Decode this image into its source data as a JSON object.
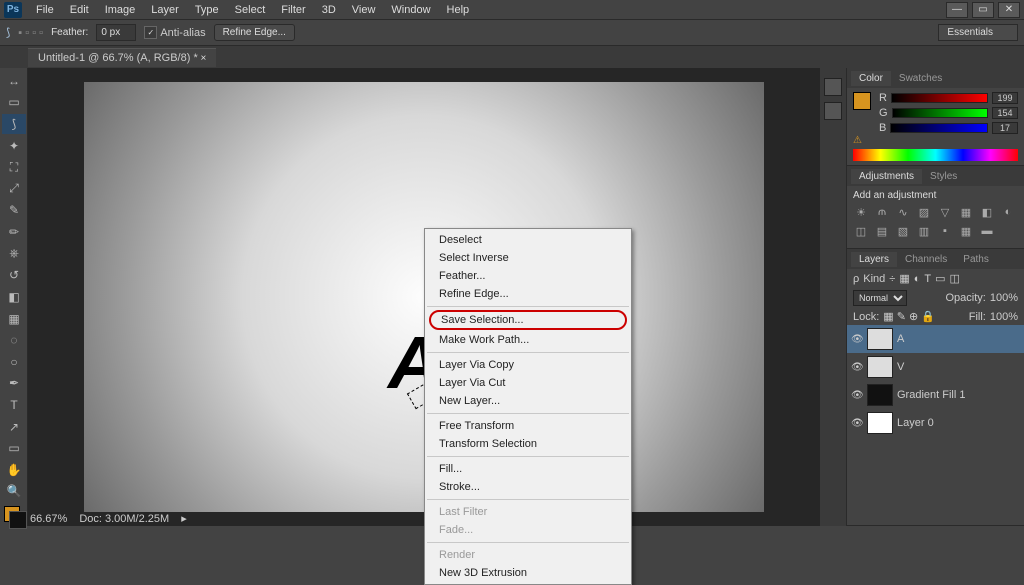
{
  "app": {
    "logo": "Ps"
  },
  "menu": [
    "File",
    "Edit",
    "Image",
    "Layer",
    "Type",
    "Select",
    "Filter",
    "3D",
    "View",
    "Window",
    "Help"
  ],
  "options": {
    "feather_label": "Feather:",
    "feather_value": "0 px",
    "antialias": "Anti-alias",
    "refine": "Refine Edge..."
  },
  "workspace": "Essentials",
  "doc_tab": "Untitled-1 @ 66.7% (A, RGB/8) *",
  "context_menu": {
    "items": [
      {
        "label": "Deselect",
        "enabled": true
      },
      {
        "label": "Select Inverse",
        "enabled": true
      },
      {
        "label": "Feather...",
        "enabled": true
      },
      {
        "label": "Refine Edge...",
        "enabled": true
      }
    ],
    "items2": [
      {
        "label": "Save Selection...",
        "enabled": true,
        "highlight": true
      },
      {
        "label": "Make Work Path...",
        "enabled": true
      }
    ],
    "items3": [
      {
        "label": "Layer Via Copy",
        "enabled": true
      },
      {
        "label": "Layer Via Cut",
        "enabled": true
      },
      {
        "label": "New Layer...",
        "enabled": true
      }
    ],
    "items4": [
      {
        "label": "Free Transform",
        "enabled": true
      },
      {
        "label": "Transform Selection",
        "enabled": true
      }
    ],
    "items5": [
      {
        "label": "Fill...",
        "enabled": true
      },
      {
        "label": "Stroke...",
        "enabled": true
      }
    ],
    "items6": [
      {
        "label": "Last Filter",
        "enabled": false
      },
      {
        "label": "Fade...",
        "enabled": false
      }
    ],
    "items7": [
      {
        "label": "Render",
        "enabled": false
      },
      {
        "label": "New 3D Extrusion",
        "enabled": true
      }
    ]
  },
  "panels": {
    "color_tab": "Color",
    "swatches_tab": "Swatches",
    "r_label": "R",
    "r_val": "199",
    "g_label": "G",
    "g_val": "154",
    "b_label": "B",
    "b_val": "17",
    "adjustments_tab": "Adjustments",
    "styles_tab": "Styles",
    "add_adjustment": "Add an adjustment",
    "layers_tab": "Layers",
    "channels_tab": "Channels",
    "paths_tab": "Paths",
    "kind_label": "Kind",
    "blend_mode": "Normal",
    "opacity_label": "Opacity:",
    "opacity_val": "100%",
    "lock_label": "Lock:",
    "fill_label": "Fill:",
    "fill_val": "100%",
    "layer_a": "A",
    "layer_v": "V",
    "layer_gf": "Gradient Fill 1",
    "layer_0": "Layer 0"
  },
  "status": {
    "zoom": "66.67%",
    "doc": "Doc: 3.00M/2.25M"
  }
}
